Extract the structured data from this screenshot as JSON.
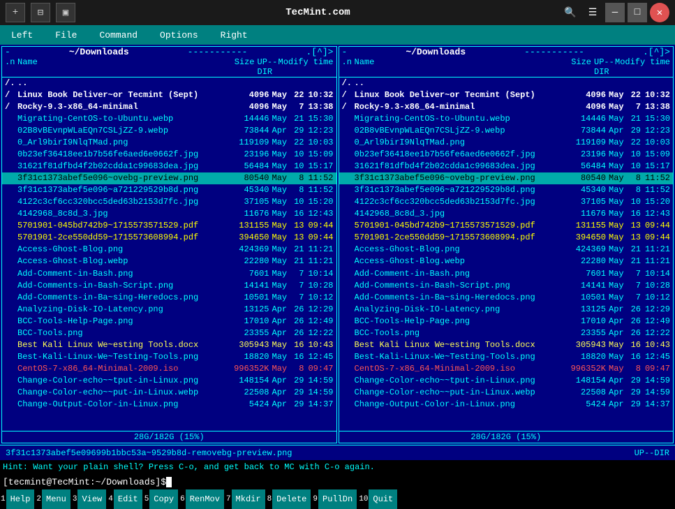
{
  "titlebar": {
    "title": "TecMint.com",
    "btn_new_tab": "+",
    "btn_split": "⊟",
    "btn_term": "▣",
    "btn_search": "🔍",
    "btn_menu": "☰",
    "btn_min": "—",
    "btn_max": "□",
    "btn_close": "✕"
  },
  "menubar": {
    "items": [
      "Left",
      "File",
      "Command",
      "Options",
      "Right"
    ]
  },
  "left_panel": {
    "path": "~/Downloads",
    "right_label": "[^]>",
    "col_n": ".n",
    "col_name": "Name",
    "col_size": "Size",
    "col_modify": "Modify",
    "col_time": "time",
    "col_sort": "UP--DIR",
    "status": "28G/182G (15%)",
    "files": [
      {
        "n": "/.",
        "name": "..",
        "size": "",
        "month": "",
        "day": "",
        "time": "",
        "type": "dir"
      },
      {
        "n": "/",
        "name": "Linux Book Deliver~or Tecmint (Sept)",
        "size": "4096",
        "month": "May",
        "day": "22",
        "time": "10:32",
        "type": "dir"
      },
      {
        "n": "/",
        "name": "Rocky-9.3-x86_64-minimal",
        "size": "4096",
        "month": "May",
        "day": "7",
        "time": "13:38",
        "type": "dir"
      },
      {
        "n": "",
        "name": "Migrating-CentOS-to-Ubuntu.webp",
        "size": "14446",
        "month": "May",
        "day": "21",
        "time": "15:30",
        "type": "file"
      },
      {
        "n": "",
        "name": "02B8vBEvnpWLaEQn7CSLjZZ-9.webp",
        "size": "73844",
        "month": "Apr",
        "day": "29",
        "time": "12:23",
        "type": "file"
      },
      {
        "n": "",
        "name": "0_Arl9birI9NlqTMad.png",
        "size": "119109",
        "month": "May",
        "day": "22",
        "time": "10:03",
        "type": "file"
      },
      {
        "n": "",
        "name": "0b23ef36418ee1b7b56fe6aed6e0662f.jpg",
        "size": "23196",
        "month": "May",
        "day": "10",
        "time": "15:09",
        "type": "file"
      },
      {
        "n": "",
        "name": "31621f81dfbd4f2b02cdda1c99683dea.jpg",
        "size": "56484",
        "month": "May",
        "day": "10",
        "time": "15:17",
        "type": "file"
      },
      {
        "n": "",
        "name": "3f31c1373abef5e096~ovebg-preview.png",
        "size": "80540",
        "month": "May",
        "day": "8",
        "time": "11:52",
        "type": "selected"
      },
      {
        "n": "",
        "name": "3f31c1373abef5e096~a721229529b8d.png",
        "size": "45340",
        "month": "May",
        "day": "8",
        "time": "11:52",
        "type": "file"
      },
      {
        "n": "",
        "name": "4122c3cf6cc320bcc5ded63b2153d7fc.jpg",
        "size": "37105",
        "month": "May",
        "day": "10",
        "time": "15:20",
        "type": "file"
      },
      {
        "n": "",
        "name": "4142968_8c8d_3.jpg",
        "size": "11676",
        "month": "May",
        "day": "16",
        "time": "12:43",
        "type": "file"
      },
      {
        "n": "",
        "name": "5701901-045bd742b9~1715573571529.pdf",
        "size": "131155",
        "month": "May",
        "day": "13",
        "time": "09:44",
        "type": "pdf"
      },
      {
        "n": "",
        "name": "5701901-2ce550dd59~1715573608994.pdf",
        "size": "394650",
        "month": "May",
        "day": "13",
        "time": "09:44",
        "type": "pdf"
      },
      {
        "n": "",
        "name": "Access-Ghost-Blog.png",
        "size": "424369",
        "month": "May",
        "day": "21",
        "time": "11:21",
        "type": "file"
      },
      {
        "n": "",
        "name": "Access-Ghost-Blog.webp",
        "size": "22280",
        "month": "May",
        "day": "21",
        "time": "11:21",
        "type": "file"
      },
      {
        "n": "",
        "name": "Add-Comment-in-Bash.png",
        "size": "7601",
        "month": "May",
        "day": "7",
        "time": "10:14",
        "type": "file"
      },
      {
        "n": "",
        "name": "Add-Comments-in-Bash-Script.png",
        "size": "14141",
        "month": "May",
        "day": "7",
        "time": "10:28",
        "type": "file"
      },
      {
        "n": "",
        "name": "Add-Comments-in-Ba~sing-Heredocs.png",
        "size": "10501",
        "month": "May",
        "day": "7",
        "time": "10:12",
        "type": "file"
      },
      {
        "n": "",
        "name": "Analyzing-Disk-IO-Latency.png",
        "size": "13125",
        "month": "Apr",
        "day": "26",
        "time": "12:29",
        "type": "file"
      },
      {
        "n": "",
        "name": "BCC-Tools-Help-Page.png",
        "size": "17010",
        "month": "Apr",
        "day": "26",
        "time": "12:49",
        "type": "file"
      },
      {
        "n": "",
        "name": "BCC-Tools.png",
        "size": "23355",
        "month": "Apr",
        "day": "26",
        "time": "12:22",
        "type": "file"
      },
      {
        "n": "",
        "name": "Best Kali Linux We~esting Tools.docx",
        "size": "305943",
        "month": "May",
        "day": "16",
        "time": "10:43",
        "type": "docx"
      },
      {
        "n": "",
        "name": "Best-Kali-Linux-We~Testing-Tools.png",
        "size": "18820",
        "month": "May",
        "day": "16",
        "time": "12:45",
        "type": "file"
      },
      {
        "n": "",
        "name": "CentOS-7-x86_64-Minimal-2009.iso",
        "size": "996352K",
        "month": "May",
        "day": "8",
        "time": "09:47",
        "type": "iso"
      },
      {
        "n": "",
        "name": "Change-Color-echo~~tput-in-Linux.png",
        "size": "148154",
        "month": "Apr",
        "day": "29",
        "time": "14:59",
        "type": "file"
      },
      {
        "n": "",
        "name": "Change-Color-echo~~put-in-Linux.webp",
        "size": "22508",
        "month": "Apr",
        "day": "29",
        "time": "14:59",
        "type": "file"
      },
      {
        "n": "",
        "name": "Change-Output-Color-in-Linux.png",
        "size": "5424",
        "month": "Apr",
        "day": "29",
        "time": "14:37",
        "type": "file"
      }
    ]
  },
  "right_panel": {
    "path": "~/Downloads",
    "right_label": "[^]>",
    "col_n": ".n",
    "col_name": "Name",
    "col_size": "Size",
    "col_modify": "Modify",
    "col_time": "time",
    "col_sort": "UP--DIR",
    "status": "28G/182G (15%)",
    "files": [
      {
        "n": "/.",
        "name": "..",
        "size": "",
        "month": "",
        "day": "",
        "time": "",
        "type": "dir"
      },
      {
        "n": "/",
        "name": "Linux Book Deliver~or Tecmint (Sept)",
        "size": "4096",
        "month": "May",
        "day": "22",
        "time": "10:32",
        "type": "dir"
      },
      {
        "n": "/",
        "name": "Rocky-9.3-x86_64-minimal",
        "size": "4096",
        "month": "May",
        "day": "7",
        "time": "13:38",
        "type": "dir"
      },
      {
        "n": "",
        "name": "Migrating-CentOS-to-Ubuntu.webp",
        "size": "14446",
        "month": "May",
        "day": "21",
        "time": "15:30",
        "type": "file"
      },
      {
        "n": "",
        "name": "02B8vBEvnpWLaEQn7CSLjZZ-9.webp",
        "size": "73844",
        "month": "Apr",
        "day": "29",
        "time": "12:23",
        "type": "file"
      },
      {
        "n": "",
        "name": "0_Arl9birI9NlqTMad.png",
        "size": "119109",
        "month": "May",
        "day": "22",
        "time": "10:03",
        "type": "file"
      },
      {
        "n": "",
        "name": "0b23ef36418ee1b7b56fe6aed6e0662f.jpg",
        "size": "23196",
        "month": "May",
        "day": "10",
        "time": "15:09",
        "type": "file"
      },
      {
        "n": "",
        "name": "31621f81dfbd4f2b02cdda1c99683dea.jpg",
        "size": "56484",
        "month": "May",
        "day": "10",
        "time": "15:17",
        "type": "file"
      },
      {
        "n": "",
        "name": "3f31c1373abef5e096~ovebg-preview.png",
        "size": "80540",
        "month": "May",
        "day": "8",
        "time": "11:52",
        "type": "selected"
      },
      {
        "n": "",
        "name": "3f31c1373abef5e096~a721229529b8d.png",
        "size": "45340",
        "month": "May",
        "day": "8",
        "time": "11:52",
        "type": "file"
      },
      {
        "n": "",
        "name": "4122c3cf6cc320bcc5ded63b2153d7fc.jpg",
        "size": "37105",
        "month": "May",
        "day": "10",
        "time": "15:20",
        "type": "file"
      },
      {
        "n": "",
        "name": "4142968_8c8d_3.jpg",
        "size": "11676",
        "month": "May",
        "day": "16",
        "time": "12:43",
        "type": "file"
      },
      {
        "n": "",
        "name": "5701901-045bd742b9~1715573571529.pdf",
        "size": "131155",
        "month": "May",
        "day": "13",
        "time": "09:44",
        "type": "pdf"
      },
      {
        "n": "",
        "name": "5701901-2ce550dd59~1715573608994.pdf",
        "size": "394650",
        "month": "May",
        "day": "13",
        "time": "09:44",
        "type": "pdf"
      },
      {
        "n": "",
        "name": "Access-Ghost-Blog.png",
        "size": "424369",
        "month": "May",
        "day": "21",
        "time": "11:21",
        "type": "file"
      },
      {
        "n": "",
        "name": "Access-Ghost-Blog.webp",
        "size": "22280",
        "month": "May",
        "day": "21",
        "time": "11:21",
        "type": "file"
      },
      {
        "n": "",
        "name": "Add-Comment-in-Bash.png",
        "size": "7601",
        "month": "May",
        "day": "7",
        "time": "10:14",
        "type": "file"
      },
      {
        "n": "",
        "name": "Add-Comments-in-Bash-Script.png",
        "size": "14141",
        "month": "May",
        "day": "7",
        "time": "10:28",
        "type": "file"
      },
      {
        "n": "",
        "name": "Add-Comments-in-Ba~sing-Heredocs.png",
        "size": "10501",
        "month": "May",
        "day": "7",
        "time": "10:12",
        "type": "file"
      },
      {
        "n": "",
        "name": "Analyzing-Disk-IO-Latency.png",
        "size": "13125",
        "month": "Apr",
        "day": "26",
        "time": "12:29",
        "type": "file"
      },
      {
        "n": "",
        "name": "BCC-Tools-Help-Page.png",
        "size": "17010",
        "month": "Apr",
        "day": "26",
        "time": "12:49",
        "type": "file"
      },
      {
        "n": "",
        "name": "BCC-Tools.png",
        "size": "23355",
        "month": "Apr",
        "day": "26",
        "time": "12:22",
        "type": "file"
      },
      {
        "n": "",
        "name": "Best Kali Linux We~esting Tools.docx",
        "size": "305943",
        "month": "May",
        "day": "16",
        "time": "10:43",
        "type": "docx"
      },
      {
        "n": "",
        "name": "Best-Kali-Linux-We~Testing-Tools.png",
        "size": "18820",
        "month": "May",
        "day": "16",
        "time": "12:45",
        "type": "file"
      },
      {
        "n": "",
        "name": "CentOS-7-x86_64-Minimal-2009.iso",
        "size": "996352K",
        "month": "May",
        "day": "8",
        "time": "09:47",
        "type": "iso"
      },
      {
        "n": "",
        "name": "Change-Color-echo~~tput-in-Linux.png",
        "size": "148154",
        "month": "Apr",
        "day": "29",
        "time": "14:59",
        "type": "file"
      },
      {
        "n": "",
        "name": "Change-Color-echo~~put-in-Linux.webp",
        "size": "22508",
        "month": "Apr",
        "day": "29",
        "time": "14:59",
        "type": "file"
      },
      {
        "n": "",
        "name": "Change-Output-Color-in-Linux.png",
        "size": "5424",
        "month": "Apr",
        "day": "29",
        "time": "14:37",
        "type": "file"
      }
    ]
  },
  "status_bar": {
    "text": "3f31c1373abef5e09699b1bbc53a~9529b8d-removebg-preview.png",
    "right": "UP--DIR"
  },
  "hint": {
    "text": "Hint: Want your plain shell? Press C-o, and get back to MC with C-o again."
  },
  "cmd_line": {
    "prompt": "[tecmint@TecMint:~/Downloads]$",
    "cursor": " "
  },
  "fkeys": [
    {
      "num": "1",
      "label": "Help"
    },
    {
      "num": "2",
      "label": "Menu"
    },
    {
      "num": "3",
      "label": "View"
    },
    {
      "num": "4",
      "label": "Edit"
    },
    {
      "num": "5",
      "label": "Copy"
    },
    {
      "num": "6",
      "label": "RenMov"
    },
    {
      "num": "7",
      "label": "Mkdir"
    },
    {
      "num": "8",
      "label": "Delete"
    },
    {
      "num": "9",
      "label": "PullDn"
    },
    {
      "num": "10",
      "label": "Quit"
    }
  ]
}
